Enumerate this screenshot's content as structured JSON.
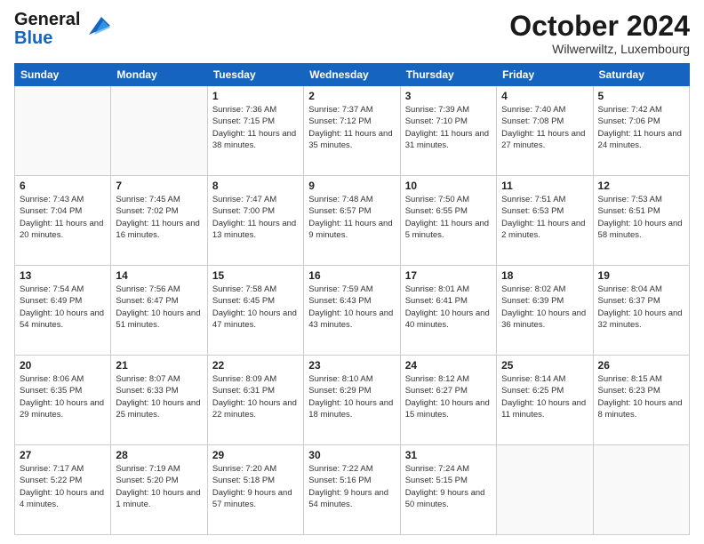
{
  "header": {
    "logo_line1": "General",
    "logo_line2": "Blue",
    "month_title": "October 2024",
    "location": "Wilwerwiltz, Luxembourg"
  },
  "days_of_week": [
    "Sunday",
    "Monday",
    "Tuesday",
    "Wednesday",
    "Thursday",
    "Friday",
    "Saturday"
  ],
  "weeks": [
    [
      {
        "day": "",
        "sunrise": "",
        "sunset": "",
        "daylight": "",
        "empty": true
      },
      {
        "day": "",
        "sunrise": "",
        "sunset": "",
        "daylight": "",
        "empty": true
      },
      {
        "day": "1",
        "sunrise": "Sunrise: 7:36 AM",
        "sunset": "Sunset: 7:15 PM",
        "daylight": "Daylight: 11 hours and 38 minutes."
      },
      {
        "day": "2",
        "sunrise": "Sunrise: 7:37 AM",
        "sunset": "Sunset: 7:12 PM",
        "daylight": "Daylight: 11 hours and 35 minutes."
      },
      {
        "day": "3",
        "sunrise": "Sunrise: 7:39 AM",
        "sunset": "Sunset: 7:10 PM",
        "daylight": "Daylight: 11 hours and 31 minutes."
      },
      {
        "day": "4",
        "sunrise": "Sunrise: 7:40 AM",
        "sunset": "Sunset: 7:08 PM",
        "daylight": "Daylight: 11 hours and 27 minutes."
      },
      {
        "day": "5",
        "sunrise": "Sunrise: 7:42 AM",
        "sunset": "Sunset: 7:06 PM",
        "daylight": "Daylight: 11 hours and 24 minutes."
      }
    ],
    [
      {
        "day": "6",
        "sunrise": "Sunrise: 7:43 AM",
        "sunset": "Sunset: 7:04 PM",
        "daylight": "Daylight: 11 hours and 20 minutes."
      },
      {
        "day": "7",
        "sunrise": "Sunrise: 7:45 AM",
        "sunset": "Sunset: 7:02 PM",
        "daylight": "Daylight: 11 hours and 16 minutes."
      },
      {
        "day": "8",
        "sunrise": "Sunrise: 7:47 AM",
        "sunset": "Sunset: 7:00 PM",
        "daylight": "Daylight: 11 hours and 13 minutes."
      },
      {
        "day": "9",
        "sunrise": "Sunrise: 7:48 AM",
        "sunset": "Sunset: 6:57 PM",
        "daylight": "Daylight: 11 hours and 9 minutes."
      },
      {
        "day": "10",
        "sunrise": "Sunrise: 7:50 AM",
        "sunset": "Sunset: 6:55 PM",
        "daylight": "Daylight: 11 hours and 5 minutes."
      },
      {
        "day": "11",
        "sunrise": "Sunrise: 7:51 AM",
        "sunset": "Sunset: 6:53 PM",
        "daylight": "Daylight: 11 hours and 2 minutes."
      },
      {
        "day": "12",
        "sunrise": "Sunrise: 7:53 AM",
        "sunset": "Sunset: 6:51 PM",
        "daylight": "Daylight: 10 hours and 58 minutes."
      }
    ],
    [
      {
        "day": "13",
        "sunrise": "Sunrise: 7:54 AM",
        "sunset": "Sunset: 6:49 PM",
        "daylight": "Daylight: 10 hours and 54 minutes."
      },
      {
        "day": "14",
        "sunrise": "Sunrise: 7:56 AM",
        "sunset": "Sunset: 6:47 PM",
        "daylight": "Daylight: 10 hours and 51 minutes."
      },
      {
        "day": "15",
        "sunrise": "Sunrise: 7:58 AM",
        "sunset": "Sunset: 6:45 PM",
        "daylight": "Daylight: 10 hours and 47 minutes."
      },
      {
        "day": "16",
        "sunrise": "Sunrise: 7:59 AM",
        "sunset": "Sunset: 6:43 PM",
        "daylight": "Daylight: 10 hours and 43 minutes."
      },
      {
        "day": "17",
        "sunrise": "Sunrise: 8:01 AM",
        "sunset": "Sunset: 6:41 PM",
        "daylight": "Daylight: 10 hours and 40 minutes."
      },
      {
        "day": "18",
        "sunrise": "Sunrise: 8:02 AM",
        "sunset": "Sunset: 6:39 PM",
        "daylight": "Daylight: 10 hours and 36 minutes."
      },
      {
        "day": "19",
        "sunrise": "Sunrise: 8:04 AM",
        "sunset": "Sunset: 6:37 PM",
        "daylight": "Daylight: 10 hours and 32 minutes."
      }
    ],
    [
      {
        "day": "20",
        "sunrise": "Sunrise: 8:06 AM",
        "sunset": "Sunset: 6:35 PM",
        "daylight": "Daylight: 10 hours and 29 minutes."
      },
      {
        "day": "21",
        "sunrise": "Sunrise: 8:07 AM",
        "sunset": "Sunset: 6:33 PM",
        "daylight": "Daylight: 10 hours and 25 minutes."
      },
      {
        "day": "22",
        "sunrise": "Sunrise: 8:09 AM",
        "sunset": "Sunset: 6:31 PM",
        "daylight": "Daylight: 10 hours and 22 minutes."
      },
      {
        "day": "23",
        "sunrise": "Sunrise: 8:10 AM",
        "sunset": "Sunset: 6:29 PM",
        "daylight": "Daylight: 10 hours and 18 minutes."
      },
      {
        "day": "24",
        "sunrise": "Sunrise: 8:12 AM",
        "sunset": "Sunset: 6:27 PM",
        "daylight": "Daylight: 10 hours and 15 minutes."
      },
      {
        "day": "25",
        "sunrise": "Sunrise: 8:14 AM",
        "sunset": "Sunset: 6:25 PM",
        "daylight": "Daylight: 10 hours and 11 minutes."
      },
      {
        "day": "26",
        "sunrise": "Sunrise: 8:15 AM",
        "sunset": "Sunset: 6:23 PM",
        "daylight": "Daylight: 10 hours and 8 minutes."
      }
    ],
    [
      {
        "day": "27",
        "sunrise": "Sunrise: 7:17 AM",
        "sunset": "Sunset: 5:22 PM",
        "daylight": "Daylight: 10 hours and 4 minutes."
      },
      {
        "day": "28",
        "sunrise": "Sunrise: 7:19 AM",
        "sunset": "Sunset: 5:20 PM",
        "daylight": "Daylight: 10 hours and 1 minute."
      },
      {
        "day": "29",
        "sunrise": "Sunrise: 7:20 AM",
        "sunset": "Sunset: 5:18 PM",
        "daylight": "Daylight: 9 hours and 57 minutes."
      },
      {
        "day": "30",
        "sunrise": "Sunrise: 7:22 AM",
        "sunset": "Sunset: 5:16 PM",
        "daylight": "Daylight: 9 hours and 54 minutes."
      },
      {
        "day": "31",
        "sunrise": "Sunrise: 7:24 AM",
        "sunset": "Sunset: 5:15 PM",
        "daylight": "Daylight: 9 hours and 50 minutes."
      },
      {
        "day": "",
        "sunrise": "",
        "sunset": "",
        "daylight": "",
        "empty": true
      },
      {
        "day": "",
        "sunrise": "",
        "sunset": "",
        "daylight": "",
        "empty": true
      }
    ]
  ]
}
